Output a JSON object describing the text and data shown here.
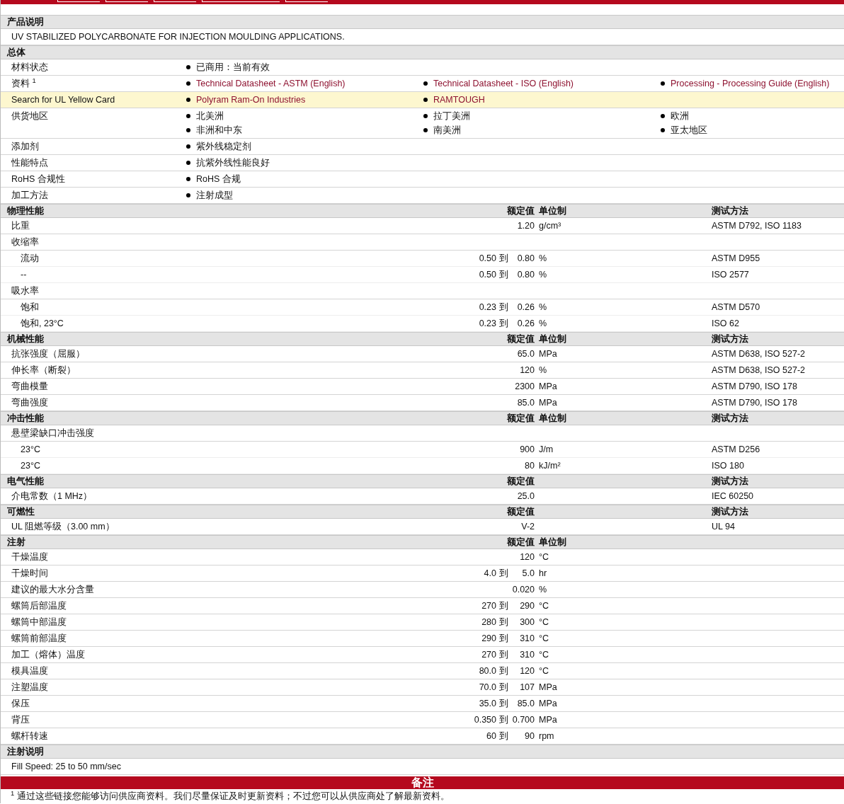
{
  "sections": [
    {
      "kind": "text",
      "title": "产品说明",
      "text": "UV STABILIZED POLYCARBONATE FOR INJECTION MOULDING APPLICATIONS."
    },
    {
      "kind": "general",
      "title": "总体",
      "rows": [
        {
          "label": "材料状态",
          "highlighted": false,
          "items": [
            {
              "text": "已商用：当前有效",
              "link": false
            }
          ]
        },
        {
          "label": "资料 $^{1}$",
          "highlighted": false,
          "items": [
            {
              "text": "Technical Datasheet - ASTM (English)",
              "link": true
            },
            {
              "text": "Technical Datasheet - ISO (English)",
              "link": true
            },
            {
              "text": "Processing - Processing Guide (English)",
              "link": true
            }
          ]
        },
        {
          "label": "Search for UL Yellow Card",
          "highlighted": true,
          "items": [
            {
              "text": "Polyram Ram-On Industries",
              "link": true
            },
            {
              "text": "RAMTOUGH",
              "link": true
            }
          ]
        },
        {
          "label": "供货地区",
          "highlighted": false,
          "items": [
            {
              "text": "北美洲",
              "link": false
            },
            {
              "text": "拉丁美洲",
              "link": false
            },
            {
              "text": "欧洲",
              "link": false
            },
            {
              "text": "非洲和中东",
              "link": false
            },
            {
              "text": "南美洲",
              "link": false
            },
            {
              "text": "亚太地区",
              "link": false
            }
          ]
        },
        {
          "label": "添加剂",
          "highlighted": false,
          "items": [
            {
              "text": "紫外线稳定剂",
              "link": false
            }
          ]
        },
        {
          "label": "性能特点",
          "highlighted": false,
          "items": [
            {
              "text": "抗紫外线性能良好",
              "link": false
            }
          ]
        },
        {
          "label": "RoHS 合规性",
          "highlighted": false,
          "items": [
            {
              "text": "RoHS 合规",
              "link": false
            }
          ]
        },
        {
          "label": "加工方法",
          "highlighted": false,
          "items": [
            {
              "text": "注射成型",
              "link": false
            }
          ]
        }
      ]
    },
    {
      "kind": "props",
      "title": "物理性能",
      "value_header": "额定值",
      "unit_header": "单位制",
      "method_header": "测试方法",
      "rows": [
        {
          "label": "比重",
          "value": "1.20",
          "unit": "g/cm³",
          "method": "ASTM D792, ISO 1183"
        },
        {
          "label": "收缩率",
          "children": [
            {
              "label": "流动",
              "min": "0.50",
              "to": "到",
              "max": "0.80",
              "unit": "%",
              "method": "ASTM D955"
            },
            {
              "label": "--",
              "min": "0.50",
              "to": "到",
              "max": "0.80",
              "unit": "%",
              "method": "ISO 2577"
            }
          ]
        },
        {
          "label": "吸水率",
          "children": [
            {
              "label": "饱和",
              "min": "0.23",
              "to": "到",
              "max": "0.26",
              "unit": "%",
              "method": "ASTM D570"
            },
            {
              "label": "饱和, 23°C",
              "min": "0.23",
              "to": "到",
              "max": "0.26",
              "unit": "%",
              "method": "ISO 62"
            }
          ]
        }
      ]
    },
    {
      "kind": "props",
      "title": "机械性能",
      "value_header": "额定值",
      "unit_header": "单位制",
      "method_header": "测试方法",
      "rows": [
        {
          "label": "抗张强度（屈服）",
          "value": "65.0",
          "unit": "MPa",
          "method": "ASTM D638, ISO 527-2"
        },
        {
          "label": "伸长率（断裂）",
          "value": "120",
          "unit": "%",
          "method": "ASTM D638, ISO 527-2"
        },
        {
          "label": "弯曲模量",
          "value": "2300",
          "unit": "MPa",
          "method": "ASTM D790, ISO 178"
        },
        {
          "label": "弯曲强度",
          "value": "85.0",
          "unit": "MPa",
          "method": "ASTM D790, ISO 178"
        }
      ]
    },
    {
      "kind": "props",
      "title": "冲击性能",
      "value_header": "额定值",
      "unit_header": "单位制",
      "method_header": "测试方法",
      "rows": [
        {
          "label": "悬壁梁缺口冲击强度",
          "children": [
            {
              "label": "23°C",
              "value": "900",
              "unit": "J/m",
              "method": "ASTM D256"
            },
            {
              "label": "23°C",
              "value": "80",
              "unit": "kJ/m²",
              "method": "ISO 180"
            }
          ]
        }
      ]
    },
    {
      "kind": "props",
      "title": "电气性能",
      "value_header": "额定值",
      "method_header": "测试方法",
      "rows": [
        {
          "label": "介电常数（1 MHz）",
          "value": "25.0",
          "method": "IEC 60250"
        }
      ]
    },
    {
      "kind": "props",
      "title": "可燃性",
      "value_header": "额定值",
      "method_header": "测试方法",
      "rows": [
        {
          "label": "UL 阻燃等级（3.00 mm）",
          "value": "V-2",
          "method": "UL 94"
        }
      ]
    },
    {
      "kind": "props",
      "title": "注射",
      "value_header": "额定值",
      "unit_header": "单位制",
      "rows": [
        {
          "label": "干燥温度",
          "value": "120",
          "unit": "°C"
        },
        {
          "label": "干燥时间",
          "min": "4.0",
          "to": "到",
          "max": "5.0",
          "unit": "hr"
        },
        {
          "label": "建议的最大水分含量",
          "value": "0.020",
          "unit": "%"
        },
        {
          "label": "螺筒后部温度",
          "min": "270",
          "to": "到",
          "max": "290",
          "unit": "°C"
        },
        {
          "label": "螺筒中部温度",
          "min": "280",
          "to": "到",
          "max": "300",
          "unit": "°C"
        },
        {
          "label": "螺筒前部温度",
          "min": "290",
          "to": "到",
          "max": "310",
          "unit": "°C"
        },
        {
          "label": "加工（熔体）温度",
          "min": "270",
          "to": "到",
          "max": "310",
          "unit": "°C"
        },
        {
          "label": "模具温度",
          "min": "80.0",
          "to": "到",
          "max": "120",
          "unit": "°C"
        },
        {
          "label": "注塑温度",
          "min": "70.0",
          "to": "到",
          "max": "107",
          "unit": "MPa"
        },
        {
          "label": "保压",
          "min": "35.0",
          "to": "到",
          "max": "85.0",
          "unit": "MPa"
        },
        {
          "label": "背压",
          "min": "0.350",
          "to": "到",
          "max": "0.700",
          "unit": "MPa"
        },
        {
          "label": "螺杆转速",
          "min": "60",
          "to": "到",
          "max": "90",
          "unit": "rpm"
        }
      ]
    },
    {
      "kind": "text",
      "title": "注射说明",
      "text": "Fill Speed: 25 to 50 mm/sec"
    }
  ],
  "notes": {
    "title": "备注",
    "text": "$^{1}$ 通过这些链接您能够访问供应商资料。我们尽量保证及时更新资料；不过您可以从供应商处了解最新资料。"
  }
}
